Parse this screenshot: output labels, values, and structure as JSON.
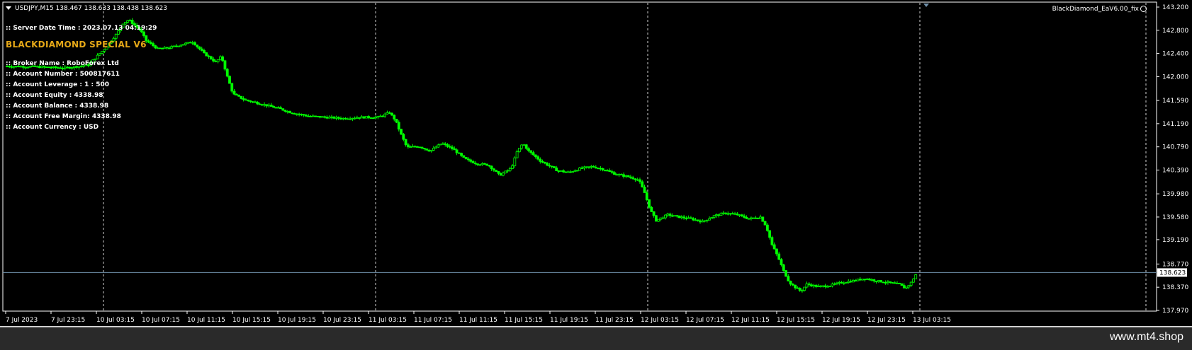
{
  "chart": {
    "symbol_line": "USDJPY,M15  138.467 138.633 138.438 138.623",
    "server_time": ":: Server Date Time : 2023.07.13 04:19:29",
    "ea_title": "BLACKDIAMOND SPECIAL V6",
    "account_info": [
      ":: Broker Name : RoboForex Ltd",
      ":: Account Number : 500817611",
      ":: Account Leverage : 1 : 500",
      ":: Account Equity : 4338.98",
      ":: Account Balance : 4338.98",
      ":: Account Free Margin: 4338.98",
      ":: Account Currency : USD"
    ],
    "ea_label": "BlackDiamond_EaV6.00_fix",
    "ea_icon": "smiley-icon",
    "current_price": "138.623",
    "colors": {
      "background": "#000000",
      "candles": "#00ff00",
      "grid": "#cfcfcf",
      "bid_line": "#6f8fa8",
      "title": "#e6a817",
      "axis_text": "#ffffff"
    }
  },
  "chart_data": {
    "type": "candlestick",
    "symbol": "USDJPY",
    "timeframe": "M15",
    "ohlc_last": {
      "open": 138.467,
      "high": 138.633,
      "low": 138.438,
      "close": 138.623
    },
    "y_ticks": [
      "143.200",
      "142.800",
      "142.400",
      "142.000",
      "141.590",
      "141.190",
      "140.790",
      "140.390",
      "139.980",
      "139.580",
      "139.190",
      "138.770",
      "138.370",
      "137.970"
    ],
    "ylim": [
      137.97,
      143.2
    ],
    "x_ticks": [
      "7 Jul 2023",
      "7 Jul 23:15",
      "10 Jul 03:15",
      "10 Jul 07:15",
      "10 Jul 11:15",
      "10 Jul 15:15",
      "10 Jul 19:15",
      "10 Jul 23:15",
      "11 Jul 03:15",
      "11 Jul 07:15",
      "11 Jul 11:15",
      "11 Jul 15:15",
      "11 Jul 19:15",
      "11 Jul 23:15",
      "12 Jul 03:15",
      "12 Jul 07:15",
      "12 Jul 11:15",
      "12 Jul 15:15",
      "12 Jul 19:15",
      "12 Jul 23:15",
      "13 Jul 03:15"
    ],
    "day_separators_after_tick": [
      "7 Jul 23:15",
      "10 Jul 23:15",
      "11 Jul 23:15",
      "12 Jul 23:15"
    ],
    "close_path": [
      [
        0,
        142.18
      ],
      [
        5,
        142.17
      ],
      [
        10,
        142.15
      ],
      [
        14,
        142.2
      ],
      [
        17,
        142.5
      ],
      [
        19,
        142.75
      ],
      [
        20,
        142.92
      ],
      [
        21,
        142.98
      ],
      [
        23,
        142.8
      ],
      [
        24,
        142.62
      ],
      [
        26,
        142.48
      ],
      [
        28,
        142.5
      ],
      [
        30,
        142.55
      ],
      [
        32,
        142.6
      ],
      [
        34,
        142.4
      ],
      [
        36,
        142.25
      ],
      [
        37,
        142.35
      ],
      [
        38,
        142.0
      ],
      [
        39,
        141.7
      ],
      [
        41,
        141.6
      ],
      [
        43,
        141.55
      ],
      [
        45,
        141.5
      ],
      [
        47,
        141.45
      ],
      [
        49,
        141.38
      ],
      [
        52,
        141.32
      ],
      [
        55,
        141.3
      ],
      [
        58,
        141.28
      ],
      [
        61,
        141.3
      ],
      [
        64,
        141.3
      ],
      [
        66,
        141.38
      ],
      [
        67,
        141.25
      ],
      [
        68,
        141.0
      ],
      [
        69,
        140.78
      ],
      [
        71,
        140.8
      ],
      [
        73,
        140.72
      ],
      [
        75,
        140.85
      ],
      [
        77,
        140.75
      ],
      [
        79,
        140.58
      ],
      [
        81,
        140.5
      ],
      [
        83,
        140.48
      ],
      [
        85,
        140.3
      ],
      [
        87,
        140.42
      ],
      [
        88,
        140.7
      ],
      [
        89,
        140.85
      ],
      [
        90,
        140.72
      ],
      [
        92,
        140.55
      ],
      [
        95,
        140.38
      ],
      [
        97,
        140.35
      ],
      [
        99,
        140.42
      ],
      [
        101,
        140.45
      ],
      [
        103,
        140.4
      ],
      [
        105,
        140.32
      ],
      [
        107,
        140.28
      ],
      [
        109,
        140.22
      ],
      [
        110,
        140.0
      ],
      [
        111,
        139.7
      ],
      [
        112,
        139.52
      ],
      [
        114,
        139.62
      ],
      [
        116,
        139.58
      ],
      [
        118,
        139.55
      ],
      [
        120,
        139.5
      ],
      [
        122,
        139.6
      ],
      [
        124,
        139.65
      ],
      [
        126,
        139.62
      ],
      [
        128,
        139.55
      ],
      [
        130,
        139.58
      ],
      [
        131,
        139.42
      ],
      [
        132,
        139.1
      ],
      [
        133,
        138.9
      ],
      [
        134,
        138.65
      ],
      [
        135,
        138.45
      ],
      [
        136,
        138.37
      ],
      [
        137,
        138.3
      ],
      [
        138,
        138.42
      ],
      [
        140,
        138.38
      ],
      [
        142,
        138.4
      ],
      [
        144,
        138.45
      ],
      [
        146,
        138.48
      ],
      [
        148,
        138.52
      ],
      [
        150,
        138.48
      ],
      [
        152,
        138.45
      ],
      [
        154,
        138.42
      ],
      [
        155,
        138.35
      ],
      [
        156,
        138.45
      ],
      [
        157,
        138.62
      ]
    ]
  }
}
